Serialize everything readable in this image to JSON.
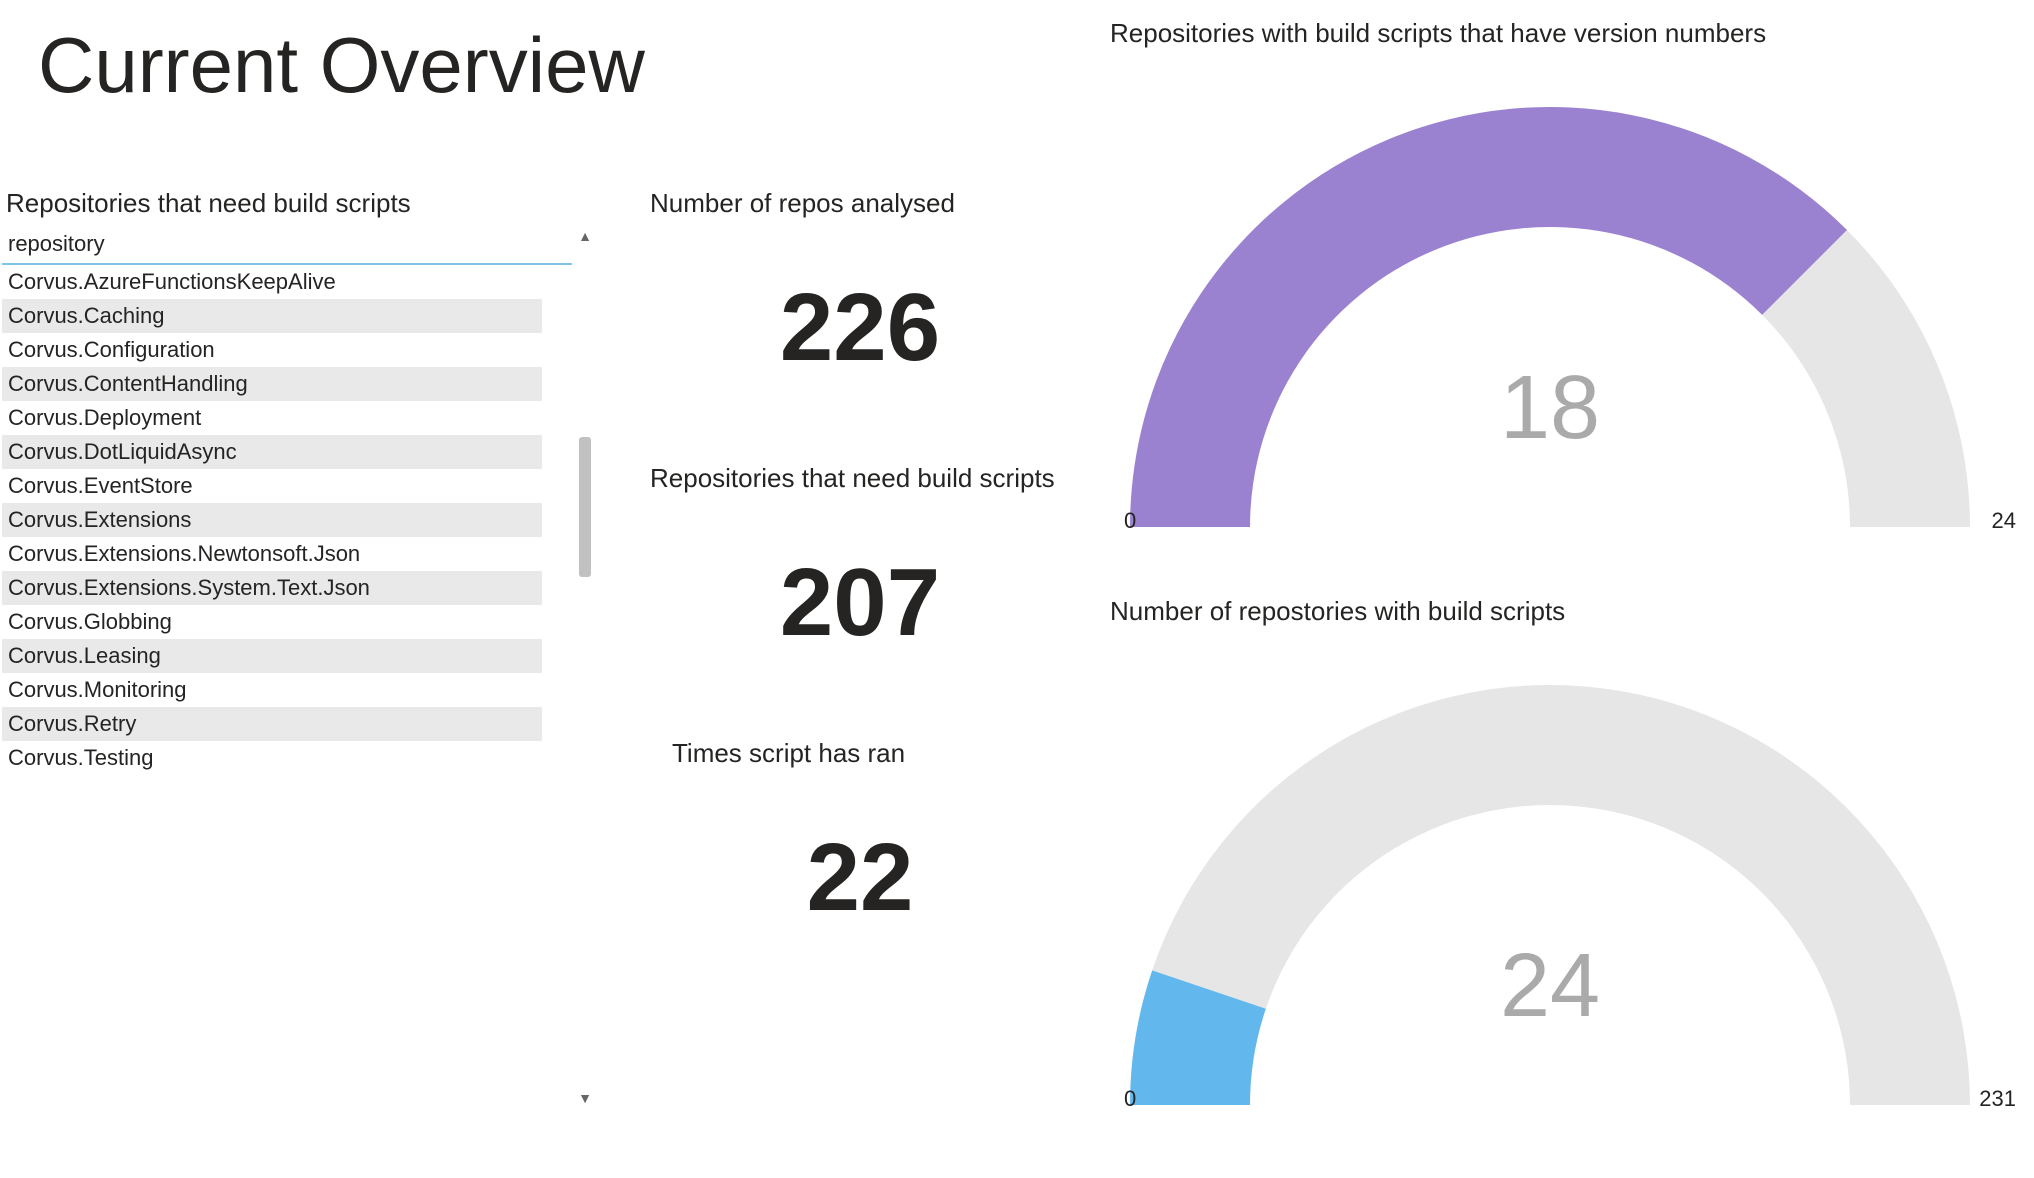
{
  "title": "Current Overview",
  "repoList": {
    "title": "Repositories that need build scripts",
    "columnHeader": "repository",
    "items": [
      "Corvus.AzureFunctionsKeepAlive",
      "Corvus.Caching",
      "Corvus.Configuration",
      "Corvus.ContentHandling",
      "Corvus.Deployment",
      "Corvus.DotLiquidAsync",
      "Corvus.EventStore",
      "Corvus.Extensions",
      "Corvus.Extensions.Newtonsoft.Json",
      "Corvus.Extensions.System.Text.Json",
      "Corvus.Globbing",
      "Corvus.Leasing",
      "Corvus.Monitoring",
      "Corvus.Retry",
      "Corvus.Testing"
    ]
  },
  "kpis": {
    "analysed": {
      "title": "Number of repos analysed",
      "value": "226"
    },
    "needScripts": {
      "title": "Repositories that need build scripts",
      "value": "207"
    },
    "timesRan": {
      "title": "Times script has ran",
      "value": "22"
    }
  },
  "gauges": {
    "versioned": {
      "title": "Repositories with build scripts that have version numbers",
      "value": 18,
      "min": 0,
      "max": 24,
      "valueLabel": "18",
      "minLabel": "0",
      "maxLabel": "24",
      "color": "#9a82d0"
    },
    "withScripts": {
      "title": "Number of repostories with build scripts",
      "value": 24,
      "min": 0,
      "max": 231,
      "valueLabel": "24",
      "minLabel": "0",
      "maxLabel": "231",
      "color": "#62b8ed"
    }
  },
  "chart_data": [
    {
      "type": "table",
      "title": "Repositories that need build scripts",
      "columns": [
        "repository"
      ],
      "rows": [
        [
          "Corvus.AzureFunctionsKeepAlive"
        ],
        [
          "Corvus.Caching"
        ],
        [
          "Corvus.Configuration"
        ],
        [
          "Corvus.ContentHandling"
        ],
        [
          "Corvus.Deployment"
        ],
        [
          "Corvus.DotLiquidAsync"
        ],
        [
          "Corvus.EventStore"
        ],
        [
          "Corvus.Extensions"
        ],
        [
          "Corvus.Extensions.Newtonsoft.Json"
        ],
        [
          "Corvus.Extensions.System.Text.Json"
        ],
        [
          "Corvus.Globbing"
        ],
        [
          "Corvus.Leasing"
        ],
        [
          "Corvus.Monitoring"
        ],
        [
          "Corvus.Retry"
        ],
        [
          "Corvus.Testing"
        ]
      ]
    },
    {
      "type": "card",
      "title": "Number of repos analysed",
      "value": 226
    },
    {
      "type": "card",
      "title": "Repositories that need build scripts",
      "value": 207
    },
    {
      "type": "card",
      "title": "Times script has ran",
      "value": 22
    },
    {
      "type": "gauge",
      "title": "Repositories with build scripts that have version numbers",
      "value": 18,
      "min": 0,
      "max": 24
    },
    {
      "type": "gauge",
      "title": "Number of repostories with build scripts",
      "value": 24,
      "min": 0,
      "max": 231
    }
  ]
}
